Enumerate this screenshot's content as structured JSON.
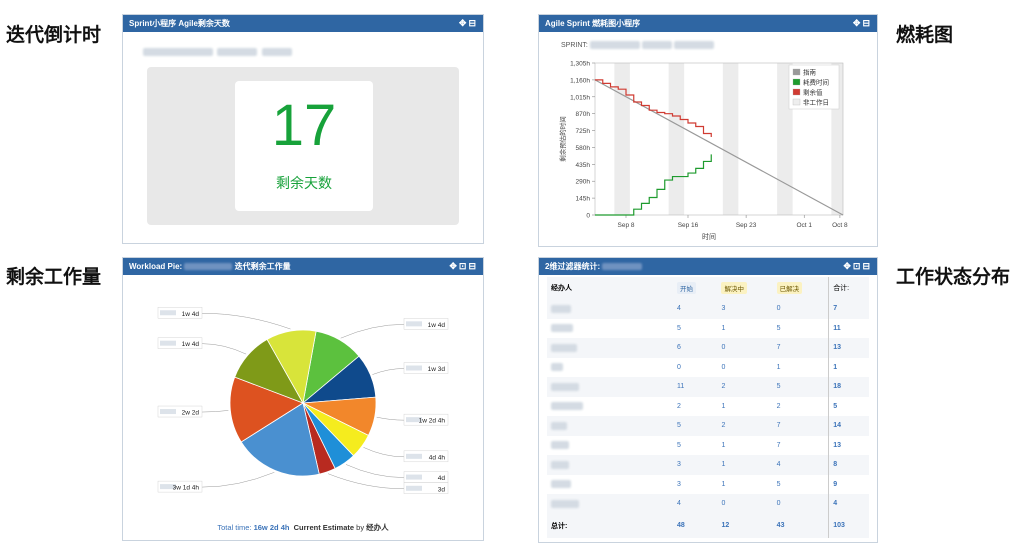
{
  "labels": {
    "countdown": "迭代倒计时",
    "burndown": "燃耗图",
    "workload": "剩余工作量",
    "status": "工作状态分布"
  },
  "countdown": {
    "header": "Sprint小程序 Agile剩余天数",
    "days": "17",
    "days_label": "剩余天数",
    "number_color": "#17a23a"
  },
  "burndown": {
    "header": "Agile Sprint 燃耗图小程序",
    "sprint_label": "SPRINT:",
    "ylabel": "剩余预估的时间",
    "xlabel": "时间",
    "legend": [
      {
        "name": "指南",
        "color": "#999999"
      },
      {
        "name": "耗费时间",
        "color": "#1e9b2e"
      },
      {
        "name": "剩余值",
        "color": "#d03b32"
      },
      {
        "name": "非工作日",
        "color": "#eeeeee"
      }
    ]
  },
  "workload": {
    "header": "Workload Pie:",
    "header_suffix": "迭代剩余工作量",
    "footer_prefix": "Total time:",
    "footer_total": "16w 2d 4h",
    "footer_mid": "Current Estimate",
    "footer_by": "by",
    "footer_field": "经办人"
  },
  "status": {
    "header": "2维过滤器统计:",
    "col_assignee": "经办人",
    "col_open": "开始",
    "col_progress": "解决中",
    "col_resolved": "已解决",
    "col_total": "合计:",
    "rows": [
      [
        "4",
        "3",
        "0",
        "7"
      ],
      [
        "5",
        "1",
        "5",
        "11"
      ],
      [
        "6",
        "0",
        "7",
        "13"
      ],
      [
        "0",
        "0",
        "1",
        "1"
      ],
      [
        "11",
        "2",
        "5",
        "18"
      ],
      [
        "2",
        "1",
        "2",
        "5"
      ],
      [
        "5",
        "2",
        "7",
        "14"
      ],
      [
        "5",
        "1",
        "7",
        "13"
      ],
      [
        "3",
        "1",
        "4",
        "8"
      ],
      [
        "3",
        "1",
        "5",
        "9"
      ],
      [
        "4",
        "0",
        "0",
        "4"
      ]
    ],
    "total_label": "总计:",
    "totals": [
      "48",
      "12",
      "43",
      "103"
    ]
  },
  "chart_data": [
    {
      "type": "line",
      "title": "",
      "xlabel": "时间",
      "ylabel": "剩余预估的时间",
      "x_ticks": [
        "Sep 8",
        "Sep 16",
        "Sep 23",
        "Oct 1",
        "Oct 8"
      ],
      "y_ticks": [
        "0",
        "145h",
        "290h",
        "435h",
        "580h",
        "725h",
        "870h",
        "1,015h",
        "1,160h",
        "1,305h"
      ],
      "ylim": [
        0,
        1305
      ],
      "legend_position": "top-right",
      "series": [
        {
          "name": "指南",
          "values": [
            [
              0,
              1160
            ],
            [
              32,
              0
            ]
          ]
        },
        {
          "name": "耗费时间",
          "values": [
            [
              0,
              0
            ],
            [
              3,
              0
            ],
            [
              5,
              50
            ],
            [
              6,
              100
            ],
            [
              7,
              150
            ],
            [
              8,
              220
            ],
            [
              9,
              300
            ],
            [
              10,
              330
            ],
            [
              11,
              330
            ],
            [
              12,
              360
            ],
            [
              13,
              400
            ],
            [
              14,
              460
            ],
            [
              15,
              520
            ]
          ]
        },
        {
          "name": "剩余值",
          "values": [
            [
              0,
              1160
            ],
            [
              1,
              1130
            ],
            [
              2,
              1100
            ],
            [
              3,
              1080
            ],
            [
              4,
              1030
            ],
            [
              5,
              970
            ],
            [
              6,
              940
            ],
            [
              7,
              900
            ],
            [
              8,
              880
            ],
            [
              9,
              870
            ],
            [
              10,
              850
            ],
            [
              11,
              820
            ],
            [
              12,
              790
            ],
            [
              13,
              760
            ],
            [
              14,
              700
            ],
            [
              15,
              670
            ]
          ]
        }
      ]
    },
    {
      "type": "pie",
      "slices": [
        {
          "label": "1w 4d",
          "value": 9,
          "color": "#5cc13e"
        },
        {
          "label": "1w 3d",
          "value": 8,
          "color": "#0f4a8c"
        },
        {
          "label": "1w 2d 4h",
          "value": 7,
          "color": "#f2872b"
        },
        {
          "label": "4d 4h",
          "value": 4.5,
          "color": "#f5ec1e"
        },
        {
          "label": "4d",
          "value": 4,
          "color": "#1f8fd8"
        },
        {
          "label": "3d",
          "value": 3,
          "color": "#b82a20"
        },
        {
          "label": "3w 1d 4h",
          "value": 16,
          "color": "#4a90d0"
        },
        {
          "label": "2w 2d",
          "value": 12,
          "color": "#dd5220"
        },
        {
          "label": "1w 4d",
          "value": 9,
          "color": "#7f9a18"
        },
        {
          "label": "1w 4d",
          "value": 9,
          "color": "#d8e43a"
        }
      ]
    }
  ]
}
